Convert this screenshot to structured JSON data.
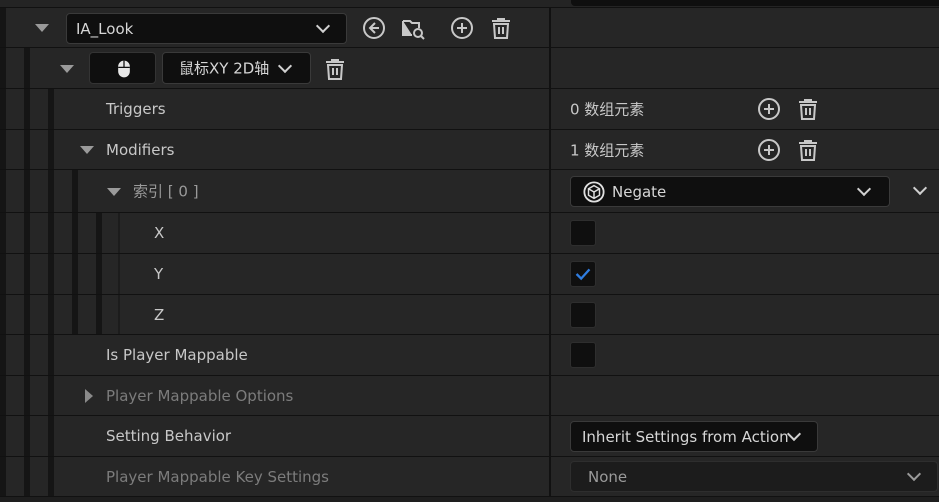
{
  "ia_row": {
    "asset_name": "IA_Look",
    "icons": [
      "browse-to-asset-icon",
      "find-in-browser-icon",
      "add-icon",
      "delete-icon"
    ]
  },
  "mapping_row": {
    "key_label": "鼠标XY 2D轴",
    "key_icon": "mouse-icon"
  },
  "triggers": {
    "label": "Triggers",
    "value": "0 数组元素"
  },
  "modifiers": {
    "label": "Modifiers",
    "value": "1 数组元素"
  },
  "index_row": {
    "label": "索引 [ 0 ]",
    "class_name": "Negate"
  },
  "axes": [
    {
      "label": "X",
      "checked": false
    },
    {
      "label": "Y",
      "checked": true
    },
    {
      "label": "Z",
      "checked": false
    }
  ],
  "is_player_mappable": {
    "label": "Is Player Mappable",
    "checked": false
  },
  "player_mappable_options": {
    "label": "Player Mappable Options"
  },
  "setting_behavior": {
    "label": "Setting Behavior",
    "value": "Inherit Settings from Action"
  },
  "player_mappable_key_settings": {
    "label": "Player Mappable Key Settings",
    "value": "None"
  },
  "colors": {
    "check_accent": "#2f7de1",
    "background": "#262626",
    "field": "#0f0f0f"
  }
}
